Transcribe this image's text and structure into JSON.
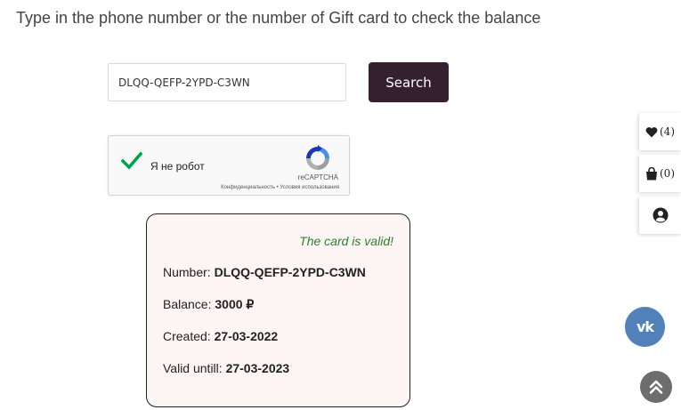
{
  "heading": "Type in the phone number or the number of Gift card to check the balance",
  "search": {
    "value": "DLQQ-QEFP-2YPD-C3WN",
    "button_label": "Search"
  },
  "recaptcha": {
    "label": "Я не робот",
    "brand": "reCAPTCHA",
    "privacy": "Конфиденциальность",
    "separator": " • ",
    "terms": "Условия использования",
    "checked": true
  },
  "result": {
    "status": "The card is valid!",
    "status_color": "#2e7d32",
    "number_label": "Number: ",
    "number_value": "DLQQ-QEFP-2YPD-C3WN",
    "balance_label": "Balance: ",
    "balance_value": "3000 ₽",
    "created_label": "Created: ",
    "created_value": "27-03-2022",
    "valid_label": "Valid untill: ",
    "valid_value": "27-03-2023"
  },
  "side_panel": {
    "wishlist_icon": "heart-icon",
    "wishlist_count": "(4)",
    "cart_icon": "shopping-bag-icon",
    "cart_count": "(0)",
    "account_icon": "user-icon"
  },
  "vk": {
    "label": "vk",
    "color": "#5181b8"
  },
  "scroll_top": {
    "icon": "double-chevron-up-icon"
  },
  "colors": {
    "button_bg": "#35202f",
    "card_bg": "#fcf5f4"
  }
}
